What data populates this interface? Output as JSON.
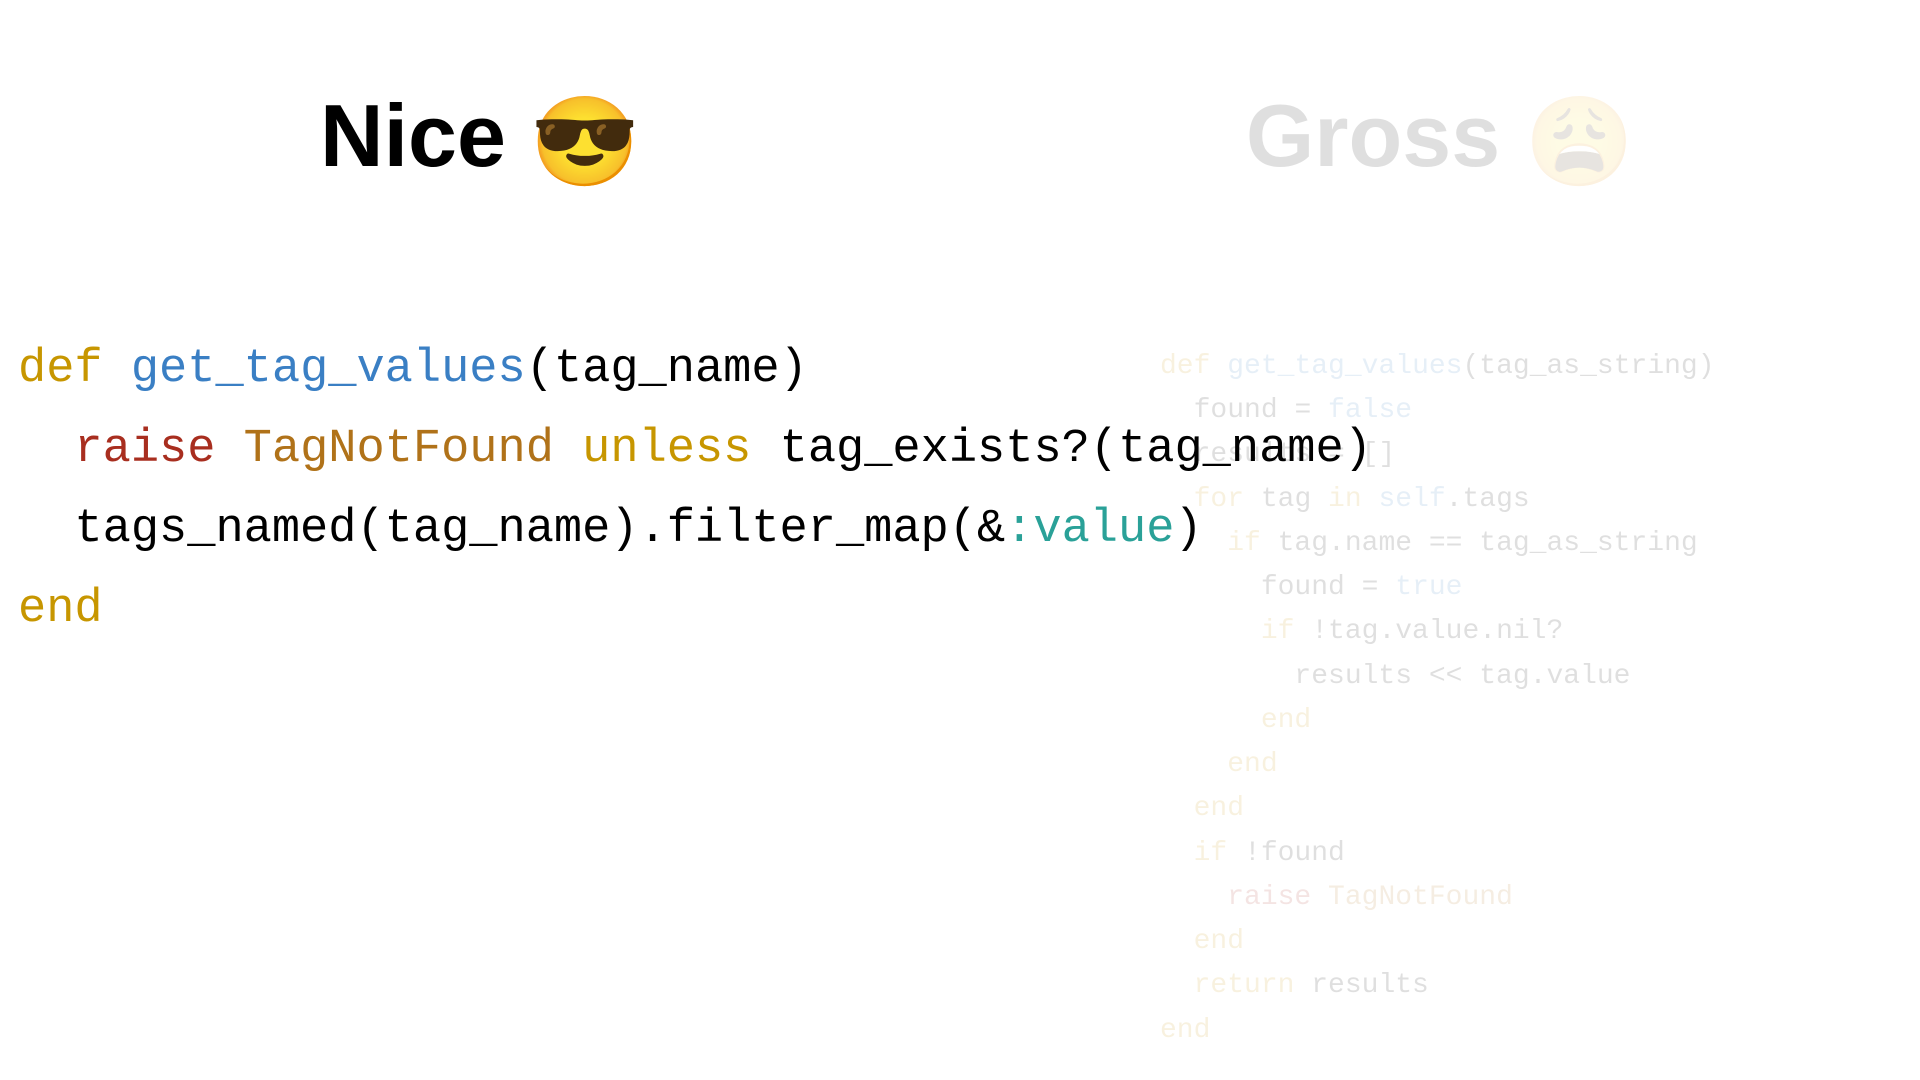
{
  "headers": {
    "nice": {
      "text": "Nice ",
      "emoji": "😎"
    },
    "gross": {
      "text": "Gross ",
      "emoji": "😩"
    }
  },
  "code_nice": {
    "line1": {
      "def": "def",
      "name": "get_tag_values",
      "params": "(tag_name)"
    },
    "line2": {
      "raise": "raise",
      "cls": "TagNotFound",
      "unless": "unless",
      "cond": "tag_exists?(tag_name)"
    },
    "line3": {
      "expr1": "tags_named(tag_name).filter_map(&",
      "sym": ":value",
      "expr2": ")"
    },
    "line4": {
      "end": "end"
    }
  },
  "code_gross": {
    "l1": {
      "def": "def",
      "name": "get_tag_values",
      "params": "(tag_as_string)"
    },
    "l2": {
      "var": "found ",
      "eq": "=",
      "val": " false"
    },
    "l3": {
      "var": "results ",
      "eq": "=",
      "val": " []"
    },
    "l4": {
      "for": "for",
      "m": " tag ",
      "in": "in",
      "s": " self",
      "rest": ".tags"
    },
    "l5": {
      "if": "if",
      "cond": " tag.name == tag_as_string"
    },
    "l6": {
      "var": "found ",
      "eq": "=",
      "val": " true"
    },
    "l7": {
      "if": "if",
      "cond": " !tag.value.nil?"
    },
    "l8": {
      "expr": "results << tag.value"
    },
    "l9": {
      "end": "end"
    },
    "l10": {
      "end": "end"
    },
    "l11": {
      "end": "end"
    },
    "l12": {
      "if": "if",
      "cond": " !found"
    },
    "l13": {
      "raise": "raise",
      "cls": " TagNotFound"
    },
    "l14": {
      "end": "end"
    },
    "l15": {
      "return": "return",
      "var": " results"
    },
    "l16": {
      "end": "end"
    }
  }
}
